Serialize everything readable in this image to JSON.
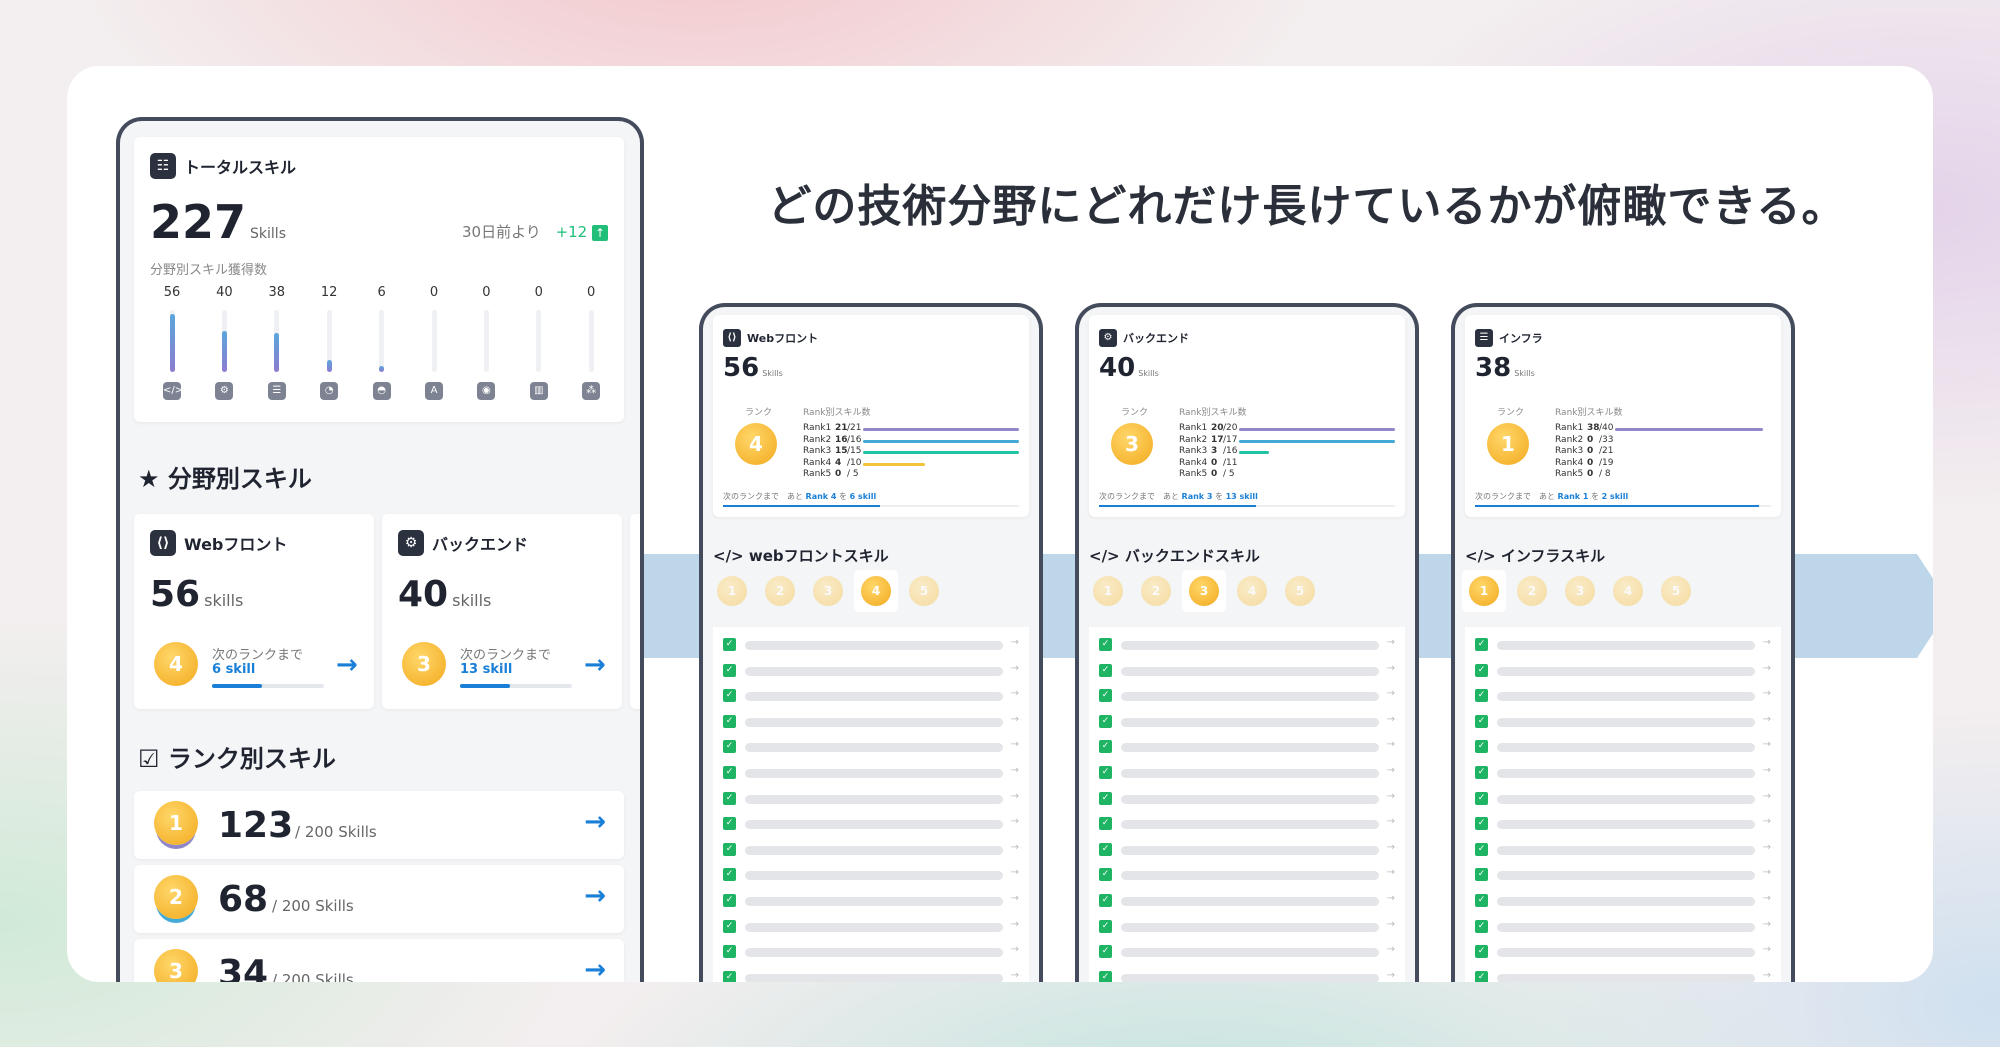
{
  "headline": "どの技術分野にどれだけ長けているかが俯瞰できる。",
  "main": {
    "total": {
      "title": "トータルスキル",
      "count": "227",
      "unit": "Skills",
      "compare_label": "30日前より",
      "compare_delta": "+12",
      "caption": "分野別スキル獲得数",
      "bars": [
        {
          "value": 56,
          "icon": "code-icon",
          "glyph": "</>"
        },
        {
          "value": 40,
          "icon": "gear-icon",
          "glyph": "⚙"
        },
        {
          "value": 38,
          "icon": "server-icon",
          "glyph": "☰"
        },
        {
          "value": 12,
          "icon": "chart-pie-icon",
          "glyph": "◔"
        },
        {
          "value": 6,
          "icon": "android-icon",
          "glyph": "◓"
        },
        {
          "value": 0,
          "icon": "text-icon",
          "glyph": "A"
        },
        {
          "value": 0,
          "icon": "game-icon",
          "glyph": "◉"
        },
        {
          "value": 0,
          "icon": "analytics-icon",
          "glyph": "▥"
        },
        {
          "value": 0,
          "icon": "cluster-icon",
          "glyph": "⁂"
        }
      ],
      "bar_max": 60
    },
    "field_section": "分野別スキル",
    "fields": [
      {
        "name": "Webフロント",
        "count": "56",
        "unit": "skills",
        "rank": "4",
        "next_label": "次のランクまで",
        "next_value": "6 skill",
        "progress": 0.45
      },
      {
        "name": "バックエンド",
        "count": "40",
        "unit": "skills",
        "rank": "3",
        "next_label": "次のランクまで",
        "next_value": "13 skill",
        "progress": 0.45
      }
    ],
    "rank_section": "ランク別スキル",
    "ranks": [
      {
        "rank": "1",
        "count": "123",
        "total": "/ 200 Skills"
      },
      {
        "rank": "2",
        "count": "68",
        "total": "/ 200 Skills"
      },
      {
        "rank": "3",
        "count": "34",
        "total": "/ 200 Skills"
      }
    ]
  },
  "panels": [
    {
      "title": "Webフロント",
      "count": "56",
      "unit": "Skills",
      "rank": "4",
      "rank_label": "ランク",
      "table_label": "Rank別スキル数",
      "rows": [
        {
          "label": "Rank1",
          "value": "21",
          "total": "/21",
          "fraction": 1.0,
          "color": "#8f87c9"
        },
        {
          "label": "Rank2",
          "value": "16",
          "total": "/16",
          "fraction": 1.0,
          "color": "#43a9d6"
        },
        {
          "label": "Rank3",
          "value": "15",
          "total": "/15",
          "fraction": 1.0,
          "color": "#21c4a2"
        },
        {
          "label": "Rank4",
          "value": "4",
          "total": "/10",
          "fraction": 0.4,
          "color": "#f2c23a"
        },
        {
          "label": "Rank5",
          "value": "0",
          "total": "/ 5",
          "fraction": 0.0,
          "color": "#f08aa0"
        }
      ],
      "next_label": "次のランクまで　あと",
      "next_rank": "Rank 4",
      "next_mid": "を",
      "next_value": "6 skill",
      "list_title": "webフロントスキル",
      "active_medal": 3
    },
    {
      "title": "バックエンド",
      "count": "40",
      "unit": "Skills",
      "rank": "3",
      "rank_label": "ランク",
      "table_label": "Rank別スキル数",
      "rows": [
        {
          "label": "Rank1",
          "value": "20",
          "total": "/20",
          "fraction": 1.0,
          "color": "#8f87c9"
        },
        {
          "label": "Rank2",
          "value": "17",
          "total": "/17",
          "fraction": 1.0,
          "color": "#43a9d6"
        },
        {
          "label": "Rank3",
          "value": "3",
          "total": "/16",
          "fraction": 0.19,
          "color": "#21c4a2"
        },
        {
          "label": "Rank4",
          "value": "0",
          "total": "/11",
          "fraction": 0.0,
          "color": "#f2c23a"
        },
        {
          "label": "Rank5",
          "value": "0",
          "total": "/ 5",
          "fraction": 0.0,
          "color": "#f08aa0"
        }
      ],
      "next_label": "次のランクまで　あと",
      "next_rank": "Rank 3",
      "next_mid": "を",
      "next_value": "13 skill",
      "list_title": "バックエンドスキル",
      "active_medal": 2
    },
    {
      "title": "インフラ",
      "count": "38",
      "unit": "Skills",
      "rank": "1",
      "rank_label": "ランク",
      "table_label": "Rank別スキル数",
      "rows": [
        {
          "label": "Rank1",
          "value": "38",
          "total": "/40",
          "fraction": 0.95,
          "color": "#8f87c9"
        },
        {
          "label": "Rank2",
          "value": "0",
          "total": "/33",
          "fraction": 0.0,
          "color": "#43a9d6"
        },
        {
          "label": "Rank3",
          "value": "0",
          "total": "/21",
          "fraction": 0.0,
          "color": "#21c4a2"
        },
        {
          "label": "Rank4",
          "value": "0",
          "total": "/19",
          "fraction": 0.0,
          "color": "#f2c23a"
        },
        {
          "label": "Rank5",
          "value": "0",
          "total": "/ 8",
          "fraction": 0.0,
          "color": "#f08aa0"
        }
      ],
      "next_label": "次のランクまで　あと",
      "next_rank": "Rank 1",
      "next_mid": "を",
      "next_value": "2 skill",
      "list_title": "インフラスキル",
      "active_medal": 0
    }
  ],
  "medal_labels": [
    "1",
    "2",
    "3",
    "4",
    "5"
  ],
  "colors": {
    "accent": "#1a7fd6",
    "check": "#1fb463",
    "delta": "#1fbf7a"
  }
}
